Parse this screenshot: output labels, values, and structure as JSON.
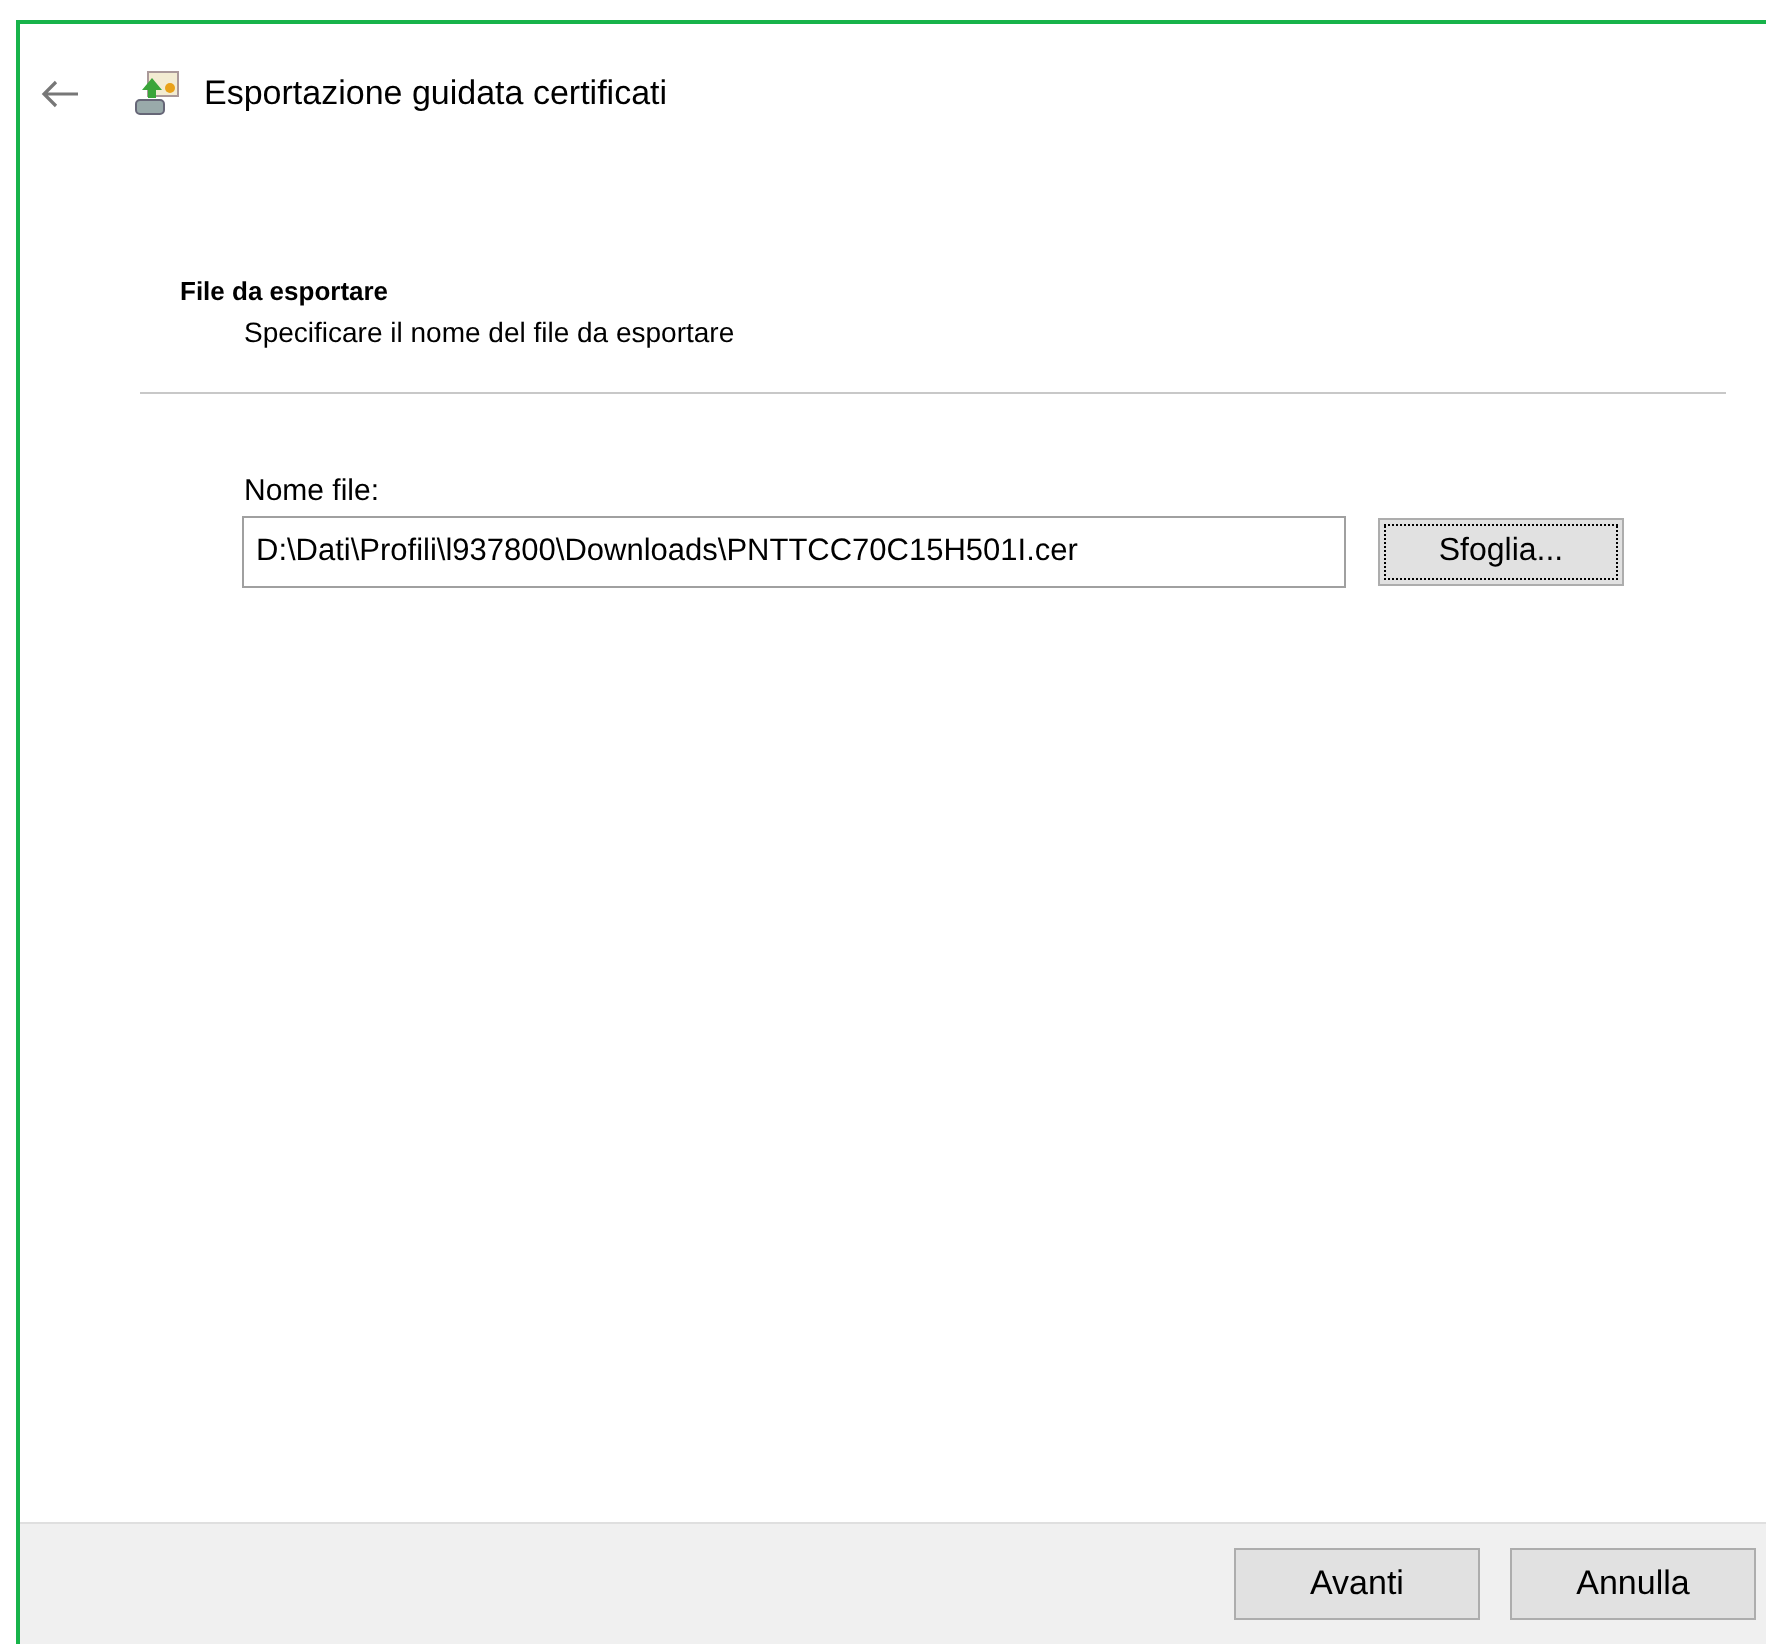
{
  "window": {
    "title": "Esportazione guidata certificati"
  },
  "page": {
    "heading": "File da esportare",
    "description": "Specificare il nome del file da esportare"
  },
  "file_field": {
    "label": "Nome file:",
    "value": "D:\\Dati\\Profili\\l937800\\Downloads\\PNTTCC70C15H501I.cer"
  },
  "browse_button": {
    "label": "Sfoglia...",
    "focused": true
  },
  "buttons": [
    {
      "label": "Avanti"
    },
    {
      "label": "Annulla"
    }
  ]
}
